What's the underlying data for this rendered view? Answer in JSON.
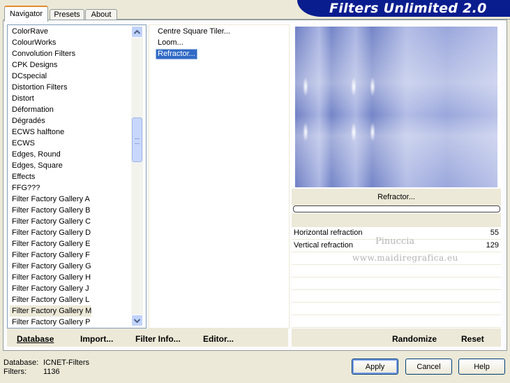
{
  "header": {
    "title": "Filters Unlimited 2.0"
  },
  "tabs": [
    {
      "label": "Navigator"
    },
    {
      "label": "Presets"
    },
    {
      "label": "About"
    }
  ],
  "categories": [
    "ColorRave",
    "ColourWorks",
    "Convolution Filters",
    "CPK Designs",
    "DCspecial",
    "Distortion Filters",
    "Distort",
    "Déformation",
    "Dégradés",
    "ECWS halftone",
    "ECWS",
    "Edges, Round",
    "Edges, Square",
    "Effects",
    "FFG???",
    "Filter Factory Gallery A",
    "Filter Factory Gallery B",
    "Filter Factory Gallery C",
    "Filter Factory Gallery D",
    "Filter Factory Gallery E",
    "Filter Factory Gallery F",
    "Filter Factory Gallery G",
    "Filter Factory Gallery H",
    "Filter Factory Gallery J",
    "Filter Factory Gallery L",
    "Filter Factory Gallery M",
    "Filter Factory Gallery P"
  ],
  "selected_category": "Filter Factory Gallery M",
  "filters": [
    "Centre Square Tiler...",
    "Loom...",
    "Refractor..."
  ],
  "selected_filter": "Refractor...",
  "preview": {
    "caption": "Refractor...",
    "progress": 0
  },
  "parameters": [
    {
      "label": "Horizontal refraction",
      "value": "55"
    },
    {
      "label": "Vertical refraction",
      "value": "129"
    }
  ],
  "watermark": {
    "line1": "Pinuccia",
    "line2": "www.maidiregrafica.eu"
  },
  "bottom_toolbar": {
    "database": "Database",
    "import": "Import...",
    "filter_info": "Filter Info...",
    "editor": "Editor...",
    "randomize": "Randomize",
    "reset": "Reset"
  },
  "status": {
    "database_label": "Database:",
    "database_value": "ICNET-Filters",
    "filters_label": "Filters:",
    "filters_value": "1136"
  },
  "buttons": {
    "apply": "Apply",
    "cancel": "Cancel",
    "help": "Help"
  },
  "colors": {
    "title_bar": "#0a1d8f",
    "selection": "#316ac5",
    "preview_base": "#8d9bd1"
  }
}
